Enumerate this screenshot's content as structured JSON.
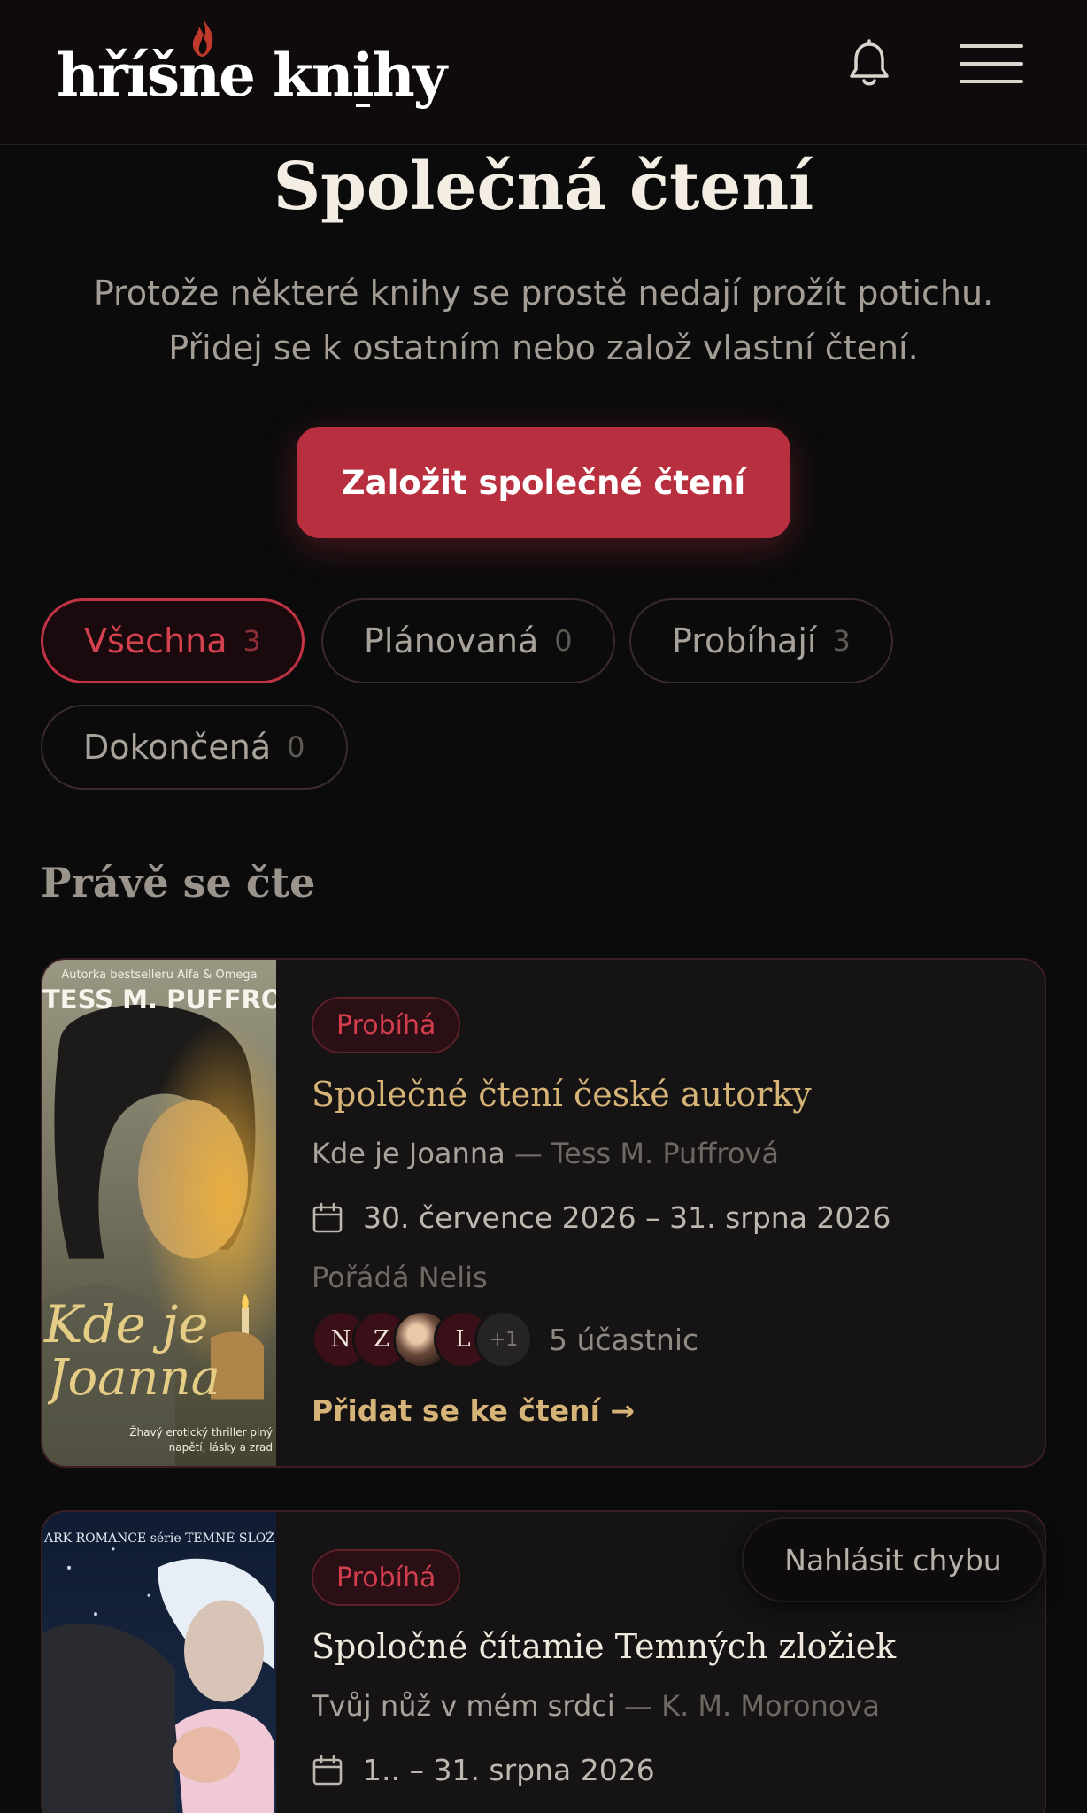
{
  "header": {
    "logo": "hříšne knihy",
    "bell_icon": "bell-icon",
    "menu_icon": "hamburger-menu-icon"
  },
  "page": {
    "title": "Společná čtení",
    "intro": "Protože některé knihy se prostě nedají prožít potichu. Přidej se k ostatním nebo založ vlastní čtení.",
    "cta": "Založit společné čtení"
  },
  "filters": [
    {
      "label": "Všechna",
      "count": "3",
      "active": true
    },
    {
      "label": "Plánovaná",
      "count": "0",
      "active": false
    },
    {
      "label": "Probíhají",
      "count": "3",
      "active": false
    },
    {
      "label": "Dokončená",
      "count": "0",
      "active": false
    }
  ],
  "section_title": "Právě se čte",
  "cards": [
    {
      "cover_top": "Autorka bestselleru Alfa & Omega",
      "cover_author": "TESS M. PUFFROVÁ",
      "cover_title_1": "Kde je",
      "cover_title_2": "Joanna",
      "cover_tagline": "Žhavý erotický thriller plný napětí, lásky a zrad",
      "status": "Probíhá",
      "title": "Společné čtení české autorky",
      "book": "Kde je Joanna",
      "separator": "—",
      "author": "Tess M. Puffrová",
      "dates": "30. července 2026 – 31. srpna 2026",
      "organizer": "Pořádá Nelis",
      "avatars": [
        "N",
        "Z",
        "",
        "L",
        "+1"
      ],
      "participants": "5 účastnic",
      "join": "Přidat se ke čtení  →"
    },
    {
      "cover_top": "ARK ROMANCE série TEMNÉ SLOŽ",
      "status": "Probíhá",
      "title": "Spoločné čítamie Temných zložiek",
      "book": "Tvůj nůž v mém srdci",
      "separator": "—",
      "author": "K. M. Moronova",
      "dates": "1.. – 31. srpna 2026"
    }
  ],
  "report_button": "Nahlásit chybu",
  "colors": {
    "background": "#0b0b0c",
    "accent_red": "#b8303f",
    "gold": "#d6b376"
  }
}
